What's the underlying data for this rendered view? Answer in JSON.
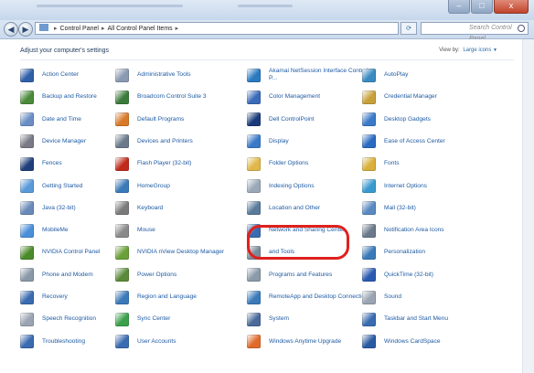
{
  "window": {
    "controls": [
      "–",
      "□",
      "x"
    ]
  },
  "address": {
    "crumbs": [
      "Control Panel",
      "All Control Panel Items"
    ],
    "search_placeholder": "Search Control Panel"
  },
  "header": {
    "title": "Adjust your computer's settings",
    "view_by_label": "View by:",
    "view_by_value": "Large icons"
  },
  "columns": [
    [
      {
        "label": "Action Center",
        "icon": "flag-icon",
        "color": "#2f5fa8"
      },
      {
        "label": "Backup and Restore",
        "icon": "backup-icon",
        "color": "#4a8a3a"
      },
      {
        "label": "Date and Time",
        "icon": "calendar-clock-icon",
        "color": "#6b8fc4"
      },
      {
        "label": "Device Manager",
        "icon": "device-manager-icon",
        "color": "#7a7a86"
      },
      {
        "label": "Fences",
        "icon": "fences-icon",
        "color": "#1f3f7a"
      },
      {
        "label": "Getting Started",
        "icon": "getting-started-icon",
        "color": "#5a9ad8"
      },
      {
        "label": "Java (32-bit)",
        "icon": "java-icon",
        "color": "#6a8ab8"
      },
      {
        "label": "MobileMe",
        "icon": "cloud-icon",
        "color": "#4a8fd8"
      },
      {
        "label": "NVIDIA Control Panel",
        "icon": "nvidia-icon",
        "color": "#4b8a2a"
      },
      {
        "label": "Phone and Modem",
        "icon": "phone-icon",
        "color": "#8a98a8"
      },
      {
        "label": "Recovery",
        "icon": "recovery-icon",
        "color": "#3a6ab0"
      },
      {
        "label": "Speech Recognition",
        "icon": "microphone-icon",
        "color": "#9aa4b2"
      },
      {
        "label": "Troubleshooting",
        "icon": "troubleshooting-icon",
        "color": "#3a6ab0"
      }
    ],
    [
      {
        "label": "Administrative Tools",
        "icon": "administrative-tools-icon",
        "color": "#8a9ab0"
      },
      {
        "label": "Broadcom Control Suite 3",
        "icon": "network-card-icon",
        "color": "#3a7a3a"
      },
      {
        "label": "Default Programs",
        "icon": "default-programs-icon",
        "color": "#d87a2a"
      },
      {
        "label": "Devices and Printers",
        "icon": "printer-icon",
        "color": "#6a7a8a"
      },
      {
        "label": "Flash Player (32-bit)",
        "icon": "flash-icon",
        "color": "#c02a1a"
      },
      {
        "label": "HomeGroup",
        "icon": "homegroup-icon",
        "color": "#3a7ab8"
      },
      {
        "label": "Keyboard",
        "icon": "keyboard-icon",
        "color": "#7a7a7a"
      },
      {
        "label": "Mouse",
        "icon": "mouse-icon",
        "color": "#8a8a8a"
      },
      {
        "label": "NVIDIA nView Desktop Manager",
        "icon": "nview-icon",
        "color": "#6aa03a"
      },
      {
        "label": "Power Options",
        "icon": "power-icon",
        "color": "#5a8a3a"
      },
      {
        "label": "Region and Language",
        "icon": "globe-icon",
        "color": "#3a7ab8"
      },
      {
        "label": "Sync Center",
        "icon": "sync-icon",
        "color": "#3aa04a"
      },
      {
        "label": "User Accounts",
        "icon": "user-accounts-icon",
        "color": "#3a6ab0"
      }
    ],
    [
      {
        "label": "Akamai NetSession Interface Control P...",
        "icon": "akamai-icon",
        "color": "#2a7ac0"
      },
      {
        "label": "Color Management",
        "icon": "color-management-icon",
        "color": "#3a6ab8"
      },
      {
        "label": "Dell ControlPoint",
        "icon": "dell-icon",
        "color": "#1a3a7a"
      },
      {
        "label": "Display",
        "icon": "display-icon",
        "color": "#3a7ac8"
      },
      {
        "label": "Folder Options",
        "icon": "folder-icon",
        "color": "#e0b84a"
      },
      {
        "label": "Indexing Options",
        "icon": "indexing-icon",
        "color": "#9aa8b8"
      },
      {
        "label": "Location and Other",
        "icon": "location-icon",
        "color": "#5a7a9a"
      },
      {
        "label": "Network and Sharing Center",
        "icon": "network-sharing-icon",
        "color": "#3a6ab0"
      },
      {
        "label": "and Tools",
        "icon": "performance-icon",
        "color": "#7a8a9a"
      },
      {
        "label": "Programs and Features",
        "icon": "programs-features-icon",
        "color": "#8a9aa8"
      },
      {
        "label": "RemoteApp and Desktop Connections",
        "icon": "remoteapp-icon",
        "color": "#3a7ab8"
      },
      {
        "label": "System",
        "icon": "system-icon",
        "color": "#4a6a9a"
      },
      {
        "label": "Windows Anytime Upgrade",
        "icon": "windows-upgrade-icon",
        "color": "#e06a2a"
      }
    ],
    [
      {
        "label": "AutoPlay",
        "icon": "autoplay-icon",
        "color": "#3a8ac0"
      },
      {
        "label": "Credential Manager",
        "icon": "credential-icon",
        "color": "#c8a03a"
      },
      {
        "label": "Desktop Gadgets",
        "icon": "gadgets-icon",
        "color": "#3a7ac8"
      },
      {
        "label": "Ease of Access Center",
        "icon": "ease-of-access-icon",
        "color": "#2a6ac0"
      },
      {
        "label": "Fonts",
        "icon": "fonts-icon",
        "color": "#d8b03a"
      },
      {
        "label": "Internet Options",
        "icon": "internet-options-icon",
        "color": "#3a9ad0"
      },
      {
        "label": "Mail (32-bit)",
        "icon": "mail-icon",
        "color": "#5a8ac0"
      },
      {
        "label": "Notification Area Icons",
        "icon": "notification-icon",
        "color": "#6a7a8a"
      },
      {
        "label": "Personalization",
        "icon": "personalization-icon",
        "color": "#3a7ab8"
      },
      {
        "label": "QuickTime (32-bit)",
        "icon": "quicktime-icon",
        "color": "#2a5ab0"
      },
      {
        "label": "Sound",
        "icon": "sound-icon",
        "color": "#9aa4b2"
      },
      {
        "label": "Taskbar and Start Menu",
        "icon": "taskbar-icon",
        "color": "#3a6ab0"
      },
      {
        "label": "Windows CardSpace",
        "icon": "cardspace-icon",
        "color": "#2a5aa0"
      }
    ]
  ],
  "highlight_color": "#e0201c"
}
